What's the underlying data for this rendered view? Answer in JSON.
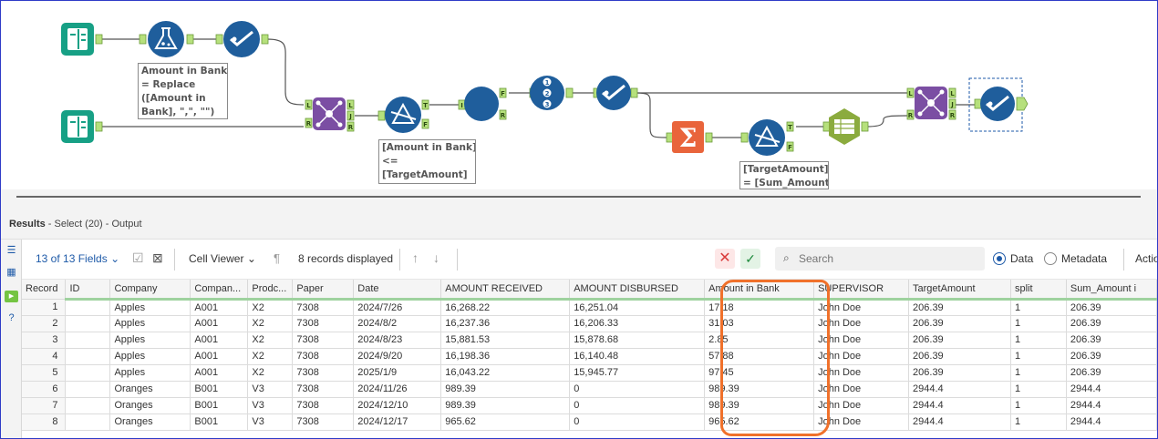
{
  "canvas": {
    "annotations": [
      "Amount in Bank\n= Replace\n([Amount in\nBank], \",\", \"\")",
      "[Amount in Bank]\n<=\n[TargetAmount]",
      "[TargetAmount]\n= [Sum_Amount"
    ],
    "anchors": {
      "join_left": "L",
      "join_right": "R",
      "join_j": "J",
      "filter_t": "T",
      "filter_f": "F",
      "formula_f": "F",
      "formula_r": "R",
      "sum_filter_t": "T",
      "sum_filter_f": "F",
      "join2_left": "L",
      "join2_right": "R",
      "join2_j": "J",
      "i": "I"
    },
    "tools": [
      "input-book-icon",
      "formula-flask-icon",
      "select-check-icon",
      "input-book-icon",
      "join-icon",
      "filter-icon",
      "formula-circle-icon",
      "record-id-icon",
      "select-check-icon",
      "summarize-sigma-icon",
      "filter-icon",
      "cross-tab-icon",
      "join-icon",
      "select-check-icon"
    ],
    "colors": {
      "blue_tool": "#1f5e9c",
      "teal_input": "#17a085",
      "purple_join": "#7b4ea3",
      "orange_sum": "#e9643b",
      "green_crosstab": "#8bab3e",
      "connector": "#555555",
      "anchor_green": "#b6e07c"
    }
  },
  "results": {
    "title": "Results",
    "subtitle": " - Select (20) - Output"
  },
  "toolbar": {
    "fields": "13 of 13 Fields",
    "cell_viewer": "Cell Viewer",
    "records_displayed": "8 records displayed",
    "search_placeholder": "Search",
    "data_label": "Data",
    "metadata_label": "Metadata",
    "actions_label": "Actio"
  },
  "table": {
    "columns": [
      "Record",
      "ID",
      "Company",
      "Compan...",
      "Prodc...",
      "Paper",
      "Date",
      "AMOUNT RECEIVED",
      "AMOUNT DISBURSED",
      "Amount in Bank",
      "SUPERVISOR",
      "TargetAmount",
      "split",
      "Sum_Amount i"
    ],
    "rows": [
      [
        "1",
        "",
        "Apples",
        "A001",
        "X2",
        "7308",
        "2024/7/26",
        "16,268.22",
        "16,251.04",
        "17.18",
        "John Doe",
        "206.39",
        "1",
        "206.39"
      ],
      [
        "2",
        "",
        "Apples",
        "A001",
        "X2",
        "7308",
        "2024/8/2",
        "16,237.36",
        "16,206.33",
        "31.03",
        "John Doe",
        "206.39",
        "1",
        "206.39"
      ],
      [
        "3",
        "",
        "Apples",
        "A001",
        "X2",
        "7308",
        "2024/8/23",
        "15,881.53",
        "15,878.68",
        "2.85",
        "John Doe",
        "206.39",
        "1",
        "206.39"
      ],
      [
        "4",
        "",
        "Apples",
        "A001",
        "X2",
        "7308",
        "2024/9/20",
        "16,198.36",
        "16,140.48",
        "57.88",
        "John Doe",
        "206.39",
        "1",
        "206.39"
      ],
      [
        "5",
        "",
        "Apples",
        "A001",
        "X2",
        "7308",
        "2025/1/9",
        "16,043.22",
        "15,945.77",
        "97.45",
        "John Doe",
        "206.39",
        "1",
        "206.39"
      ],
      [
        "6",
        "",
        "Oranges",
        "B001",
        "V3",
        "7308",
        "2024/11/26",
        "989.39",
        "0",
        "989.39",
        "John Doe",
        "2944.4",
        "1",
        "2944.4"
      ],
      [
        "7",
        "",
        "Oranges",
        "B001",
        "V3",
        "7308",
        "2024/12/10",
        "989.39",
        "0",
        "989.39",
        "John Doe",
        "2944.4",
        "1",
        "2944.4"
      ],
      [
        "8",
        "",
        "Oranges",
        "B001",
        "V3",
        "7308",
        "2024/12/17",
        "965.62",
        "0",
        "965.62",
        "John Doe",
        "2944.4",
        "1",
        "2944.4"
      ]
    ]
  }
}
